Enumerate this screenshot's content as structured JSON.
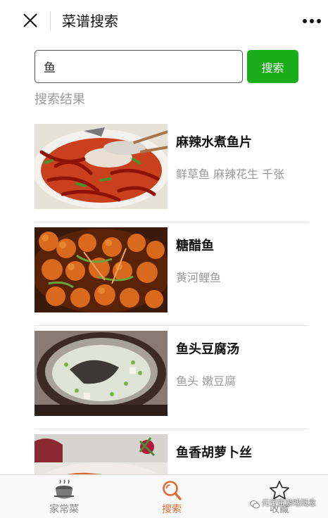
{
  "header": {
    "title": "菜谱搜索",
    "close_icon": "close-icon",
    "more_icon": "more-dots-icon"
  },
  "search": {
    "value": "鱼",
    "button_label": "搜索"
  },
  "results": {
    "heading": "搜索结果",
    "items": [
      {
        "name": "麻辣水煮鱼片",
        "ingredients": "鲜草鱼 麻辣花生 千张",
        "image": "dish-photo-spicy-fish"
      },
      {
        "name": "糖醋鱼",
        "ingredients": "黄河鲤鱼",
        "image": "dish-photo-sweet-sour-fish"
      },
      {
        "name": "鱼头豆腐汤",
        "ingredients": "鱼头 嫩豆腐",
        "image": "dish-photo-fish-head-tofu-soup"
      },
      {
        "name": "鱼香胡萝卜丝",
        "ingredients": "",
        "image": "dish-photo-carrot-shreds"
      }
    ]
  },
  "tabbar": {
    "tabs": [
      {
        "label": "家常菜",
        "icon": "cooking-pot-icon",
        "active": false
      },
      {
        "label": "搜索",
        "icon": "search-icon",
        "active": true
      },
      {
        "label": "收藏",
        "icon": "star-icon",
        "active": false
      }
    ],
    "active_color": "#e06a35",
    "inactive_color": "#8c8c8c"
  },
  "watermark": "元宇宙游戏概念",
  "colors": {
    "accent_green": "#1aad19",
    "muted_text": "#9a9a9a"
  }
}
